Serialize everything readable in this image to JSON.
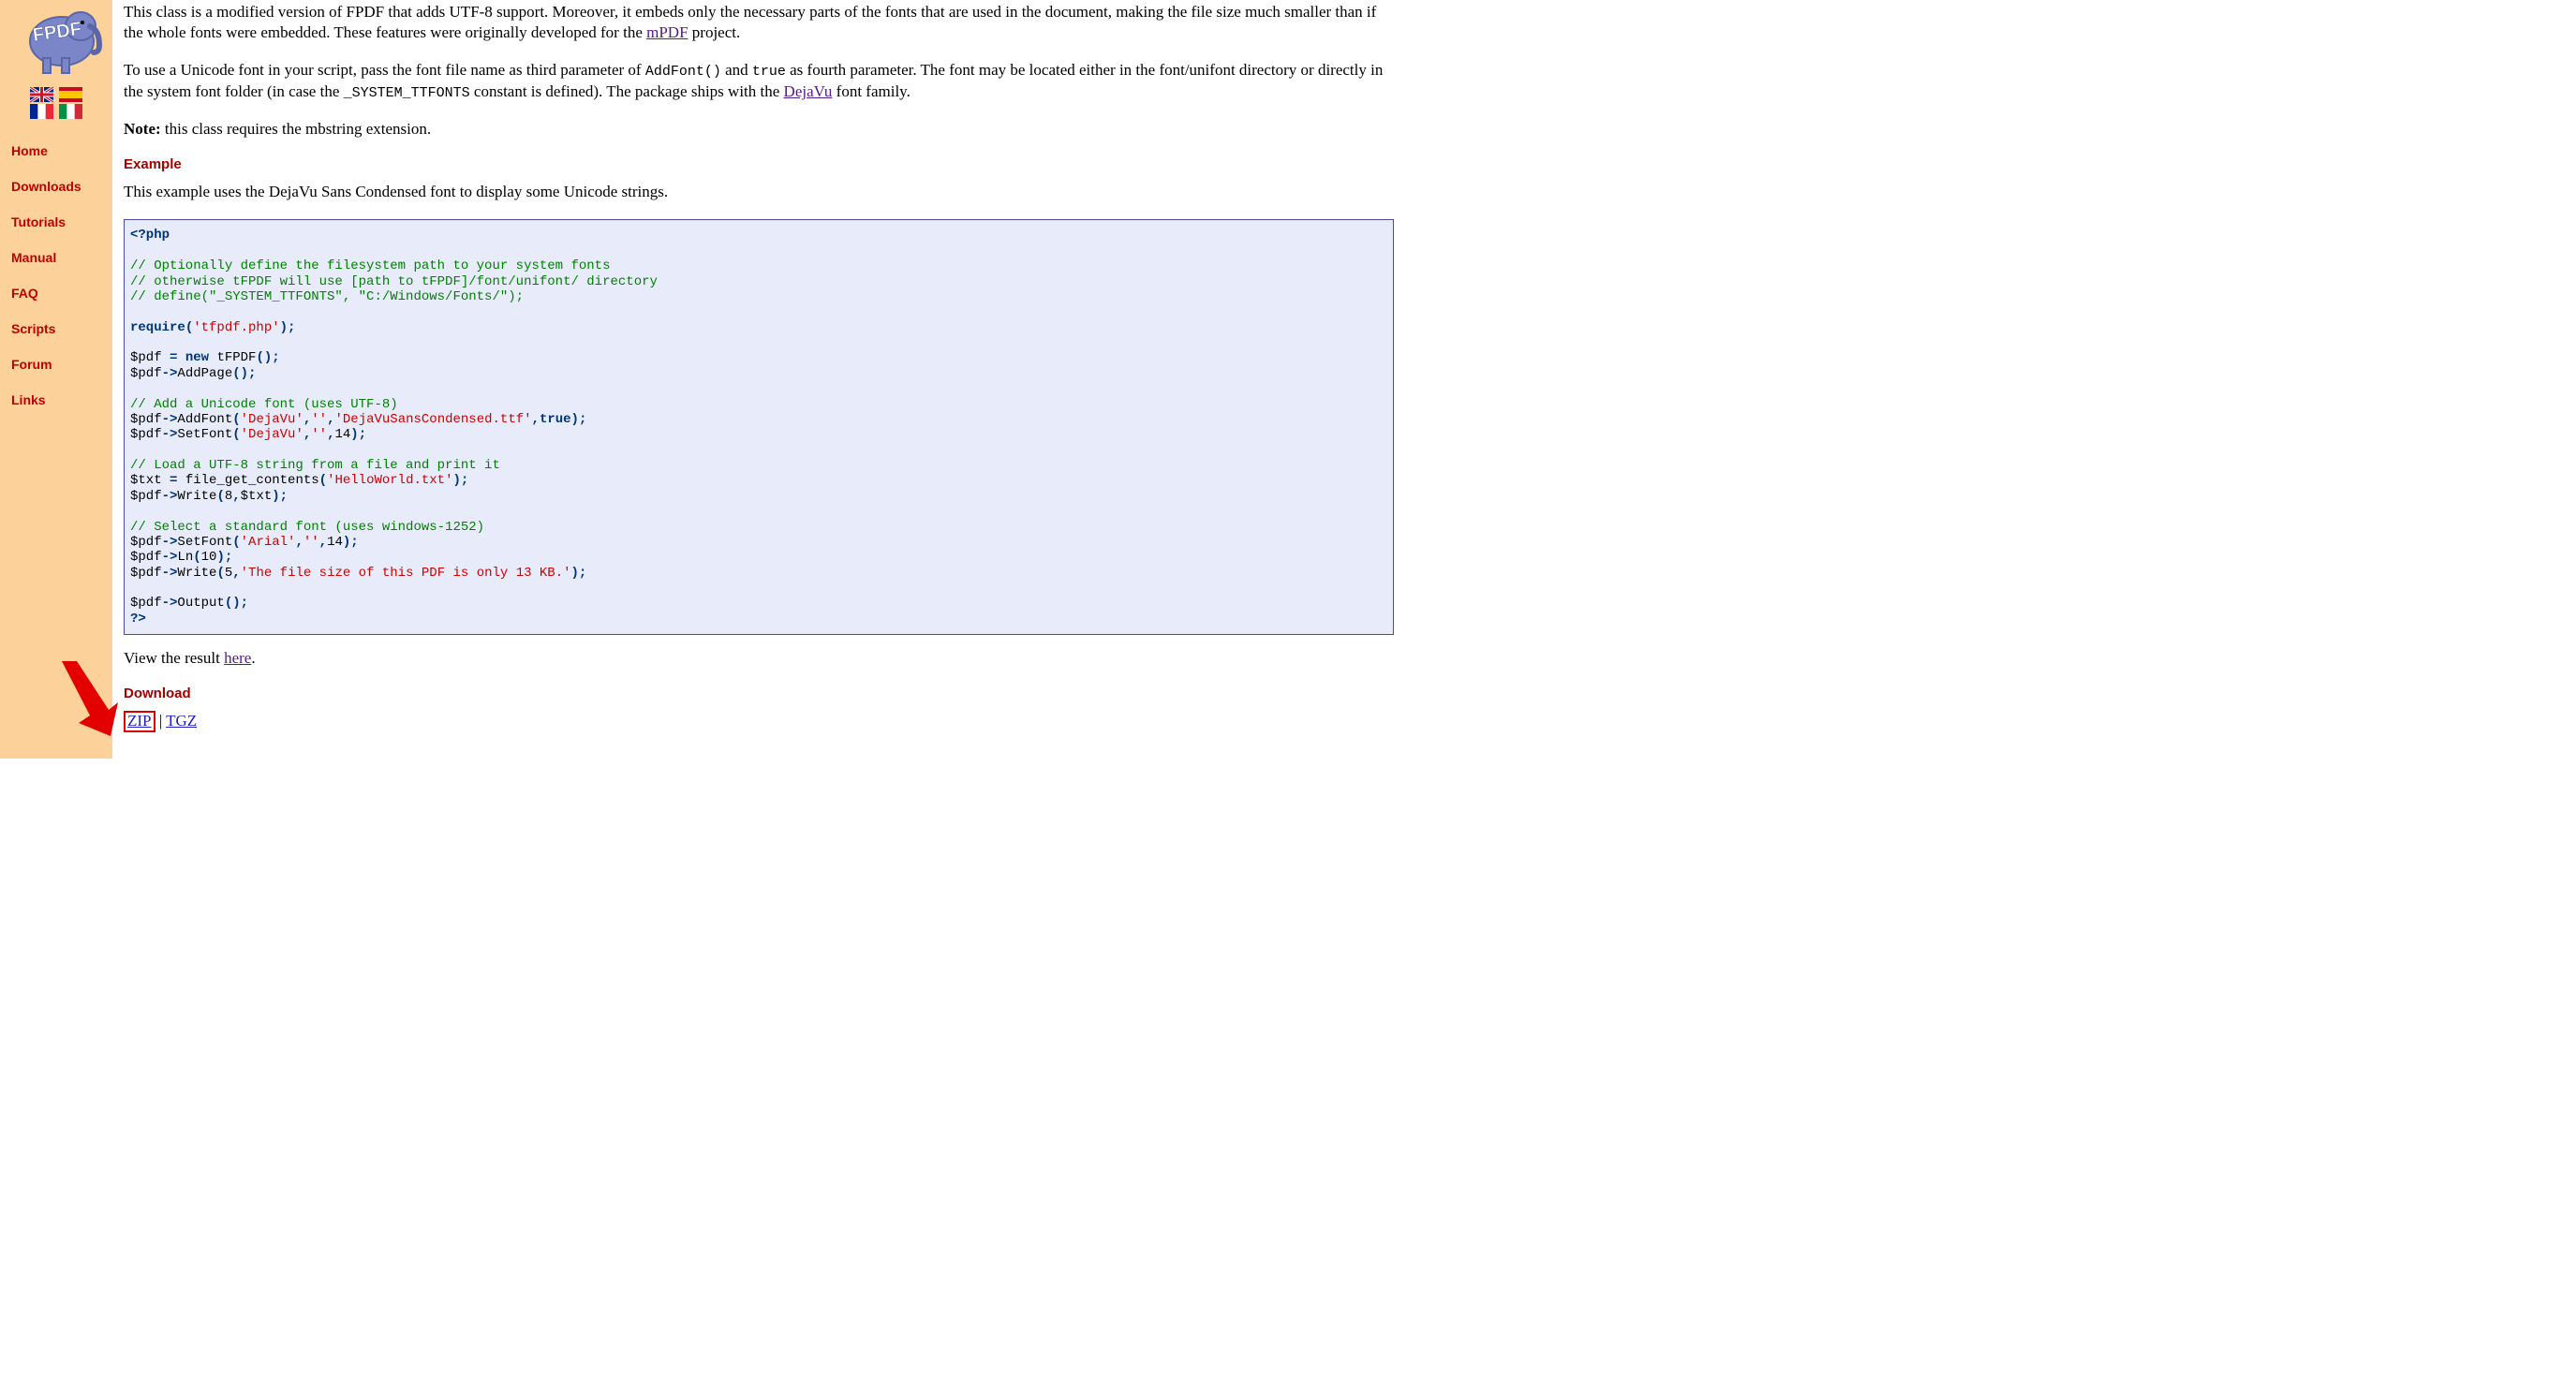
{
  "sidebar": {
    "logo_text": "FPDF",
    "nav": [
      {
        "label": "Home"
      },
      {
        "label": "Downloads"
      },
      {
        "label": "Tutorials"
      },
      {
        "label": "Manual"
      },
      {
        "label": "FAQ"
      },
      {
        "label": "Scripts"
      },
      {
        "label": "Forum"
      },
      {
        "label": "Links"
      }
    ],
    "flags": [
      "uk",
      "es",
      "fr",
      "it"
    ]
  },
  "intro": {
    "p1_pre": "This class is a modified version of FPDF that adds UTF-8 support. Moreover, it embeds only the necessary parts of the fonts that are used in the document, making the file size much smaller than if the whole fonts were embedded. These features were originally developed for the ",
    "p1_link": "mPDF",
    "p1_post": " project.",
    "p2_a": "To use a Unicode font in your script, pass the font file name as third parameter of ",
    "p2_code1": "AddFont()",
    "p2_b": " and ",
    "p2_code2": "true",
    "p2_c": " as fourth parameter. The font may be located either in the font/unifont directory or directly in the system font folder (in case the ",
    "p2_code3": "_SYSTEM_TTFONTS",
    "p2_d": " constant is defined). The package ships with the ",
    "p2_link": "DejaVu",
    "p2_e": " font family.",
    "p3_bold": "Note:",
    "p3_rest": " this class requires the mbstring extension."
  },
  "example": {
    "heading": "Example",
    "desc": "This example uses the DejaVu Sans Condensed font to display some Unicode strings."
  },
  "code": {
    "l1": "<?php",
    "l2": "// Optionally define the filesystem path to your system fonts",
    "l3": "// otherwise tFPDF will use [path to tFPDF]/font/unifont/ directory",
    "l4": "// define(\"_SYSTEM_TTFONTS\", \"C:/Windows/Fonts/\");",
    "l5_kw": "require",
    "l5_p1": "(",
    "l5_s": "'tfpdf.php'",
    "l5_p2": ");",
    "l6_a": "$pdf ",
    "l6_eq": "=",
    "l6_b": " ",
    "l6_new": "new",
    "l6_c": " tFPDF",
    "l6_p1": "();",
    "l7_a": "$pdf",
    "l7_ar": "->",
    "l7_b": "AddPage",
    "l7_p1": "();",
    "l8": "// Add a Unicode font (uses UTF-8)",
    "l9_a": "$pdf",
    "l9_ar": "->",
    "l9_b": "AddFont",
    "l9_p1": "(",
    "l9_s1": "'DejaVu'",
    "l9_c1": ",",
    "l9_s2": "''",
    "l9_c2": ",",
    "l9_s3": "'DejaVuSansCondensed.ttf'",
    "l9_c3": ",",
    "l9_tr": "true",
    "l9_p2": ");",
    "l10_a": "$pdf",
    "l10_ar": "->",
    "l10_b": "SetFont",
    "l10_p1": "(",
    "l10_s1": "'DejaVu'",
    "l10_c1": ",",
    "l10_s2": "''",
    "l10_c2": ",",
    "l10_n": "14",
    "l10_p2": ");",
    "l11": "// Load a UTF-8 string from a file and print it",
    "l12_a": "$txt ",
    "l12_eq": "=",
    "l12_b": " file_get_contents",
    "l12_p1": "(",
    "l12_s": "'HelloWorld.txt'",
    "l12_p2": ");",
    "l13_a": "$pdf",
    "l13_ar": "->",
    "l13_b": "Write",
    "l13_p1": "(",
    "l13_n": "8",
    "l13_c": ",",
    "l13_v": "$txt",
    "l13_p2": ");",
    "l14": "// Select a standard font (uses windows-1252)",
    "l15_a": "$pdf",
    "l15_ar": "->",
    "l15_b": "SetFont",
    "l15_p1": "(",
    "l15_s1": "'Arial'",
    "l15_c1": ",",
    "l15_s2": "''",
    "l15_c2": ",",
    "l15_n": "14",
    "l15_p2": ");",
    "l16_a": "$pdf",
    "l16_ar": "->",
    "l16_b": "Ln",
    "l16_p1": "(",
    "l16_n": "10",
    "l16_p2": ");",
    "l17_a": "$pdf",
    "l17_ar": "->",
    "l17_b": "Write",
    "l17_p1": "(",
    "l17_n": "5",
    "l17_c": ",",
    "l17_s": "'The file size of this PDF is only 13 KB.'",
    "l17_p2": ");",
    "l18_a": "$pdf",
    "l18_ar": "->",
    "l18_b": "Output",
    "l18_p1": "();",
    "l19": "?>"
  },
  "result": {
    "pre": "View the result ",
    "link": "here",
    "post": "."
  },
  "download": {
    "heading": "Download",
    "zip": "ZIP",
    "sep": " | ",
    "tgz": "TGZ"
  }
}
